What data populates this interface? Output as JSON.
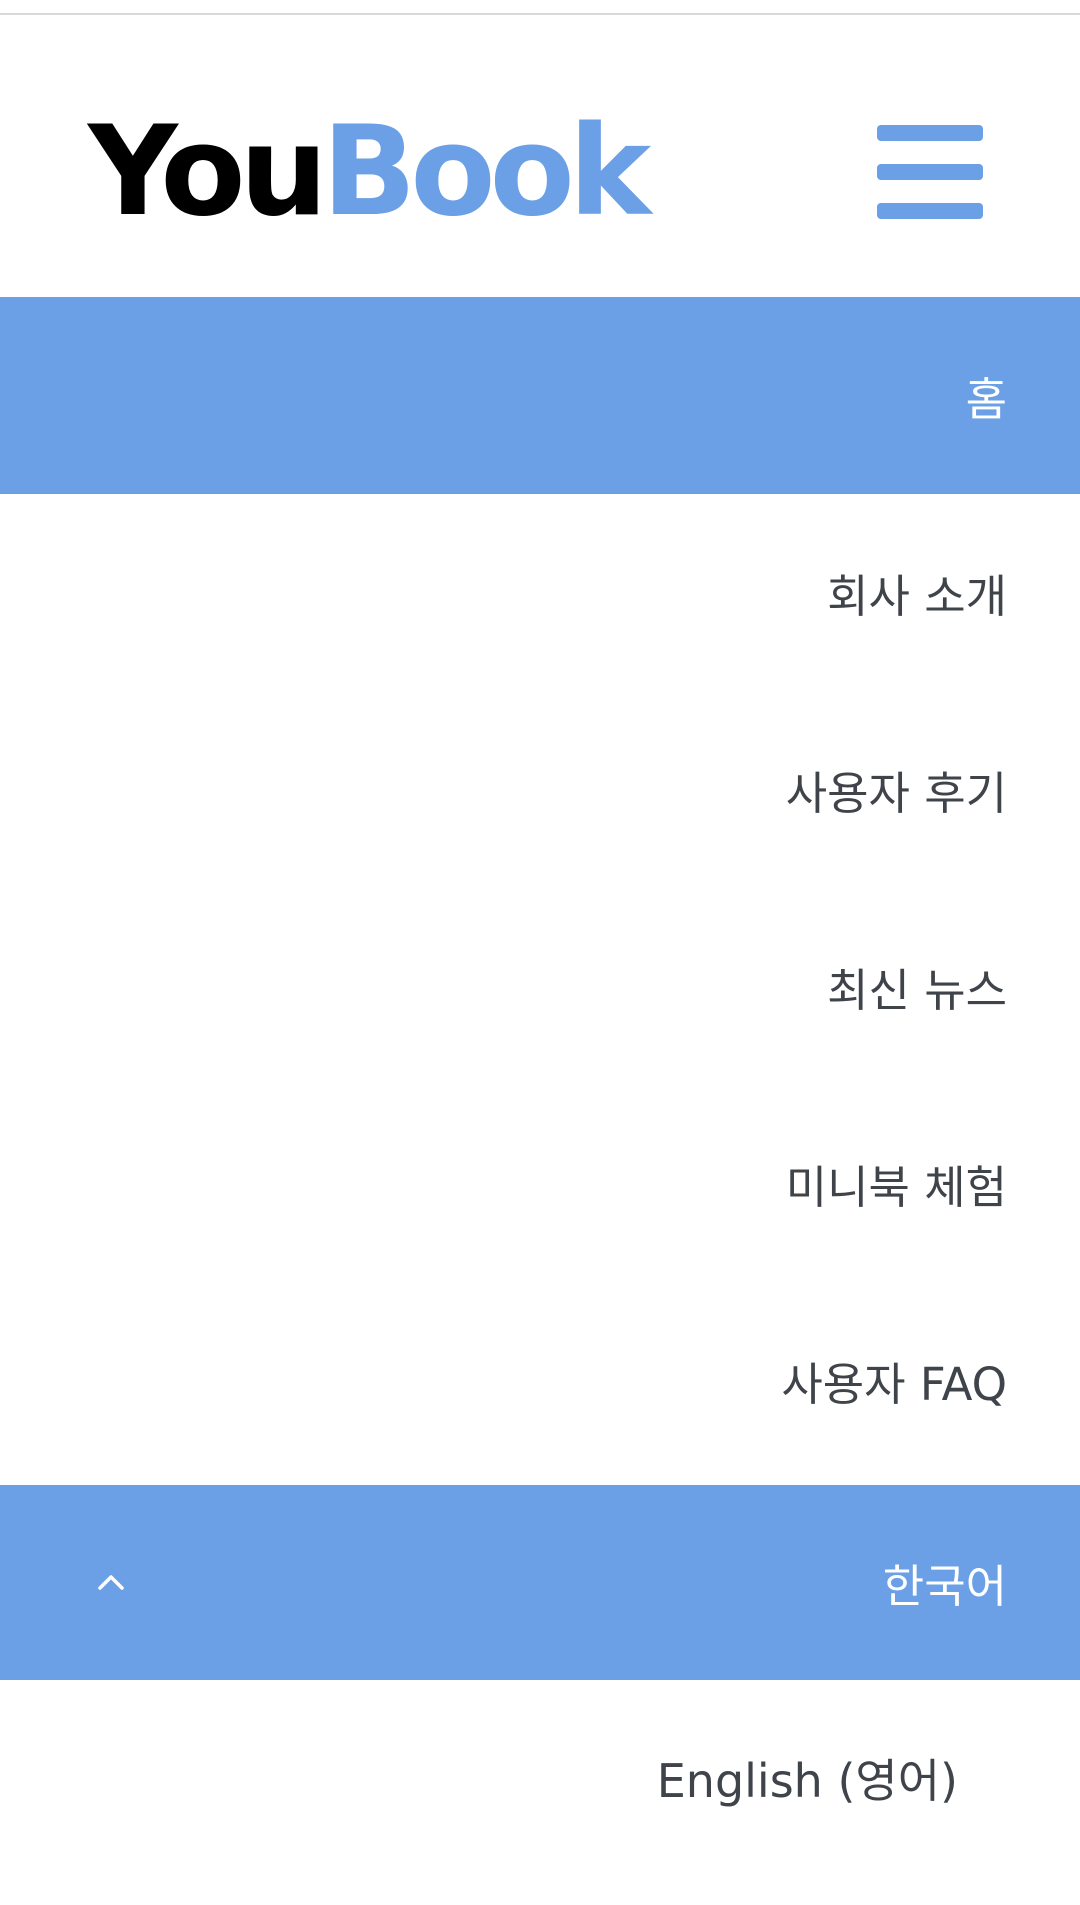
{
  "brand": {
    "part1": "You",
    "part2": "Book",
    "color_dark": "#000000",
    "color_accent": "#6b9fe6"
  },
  "header": {
    "menu_icon": "hamburger-menu-icon"
  },
  "nav": {
    "items": [
      {
        "label": "홈",
        "active": true
      },
      {
        "label": "회사 소개",
        "active": false
      },
      {
        "label": "사용자 후기",
        "active": false
      },
      {
        "label": "최신 뉴스",
        "active": false
      },
      {
        "label": "미니북 체험",
        "active": false
      },
      {
        "label": "사용자 FAQ",
        "active": false
      }
    ]
  },
  "language": {
    "current": "한국어",
    "toggle_icon": "chevron-up-icon",
    "options": [
      "English (영어)"
    ]
  },
  "colors": {
    "accent": "#6b9fe6",
    "text": "#3f434a",
    "background": "#ffffff"
  }
}
